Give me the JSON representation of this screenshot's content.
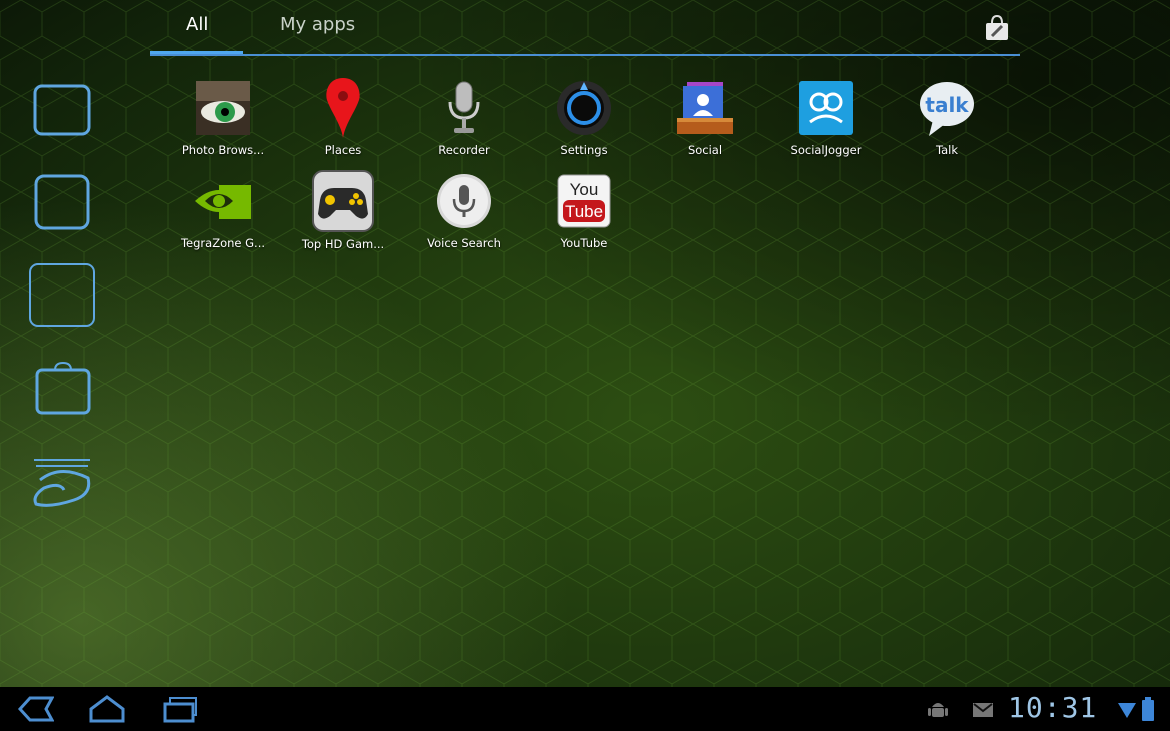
{
  "tabs": {
    "all": "All",
    "my_apps": "My apps"
  },
  "apps": [
    {
      "label": "Photo Brows...",
      "icon": "photo-browser-icon"
    },
    {
      "label": "Places",
      "icon": "places-pin-icon"
    },
    {
      "label": "Recorder",
      "icon": "microphone-icon"
    },
    {
      "label": "Settings",
      "icon": "settings-icon"
    },
    {
      "label": "Social",
      "icon": "social-contacts-icon"
    },
    {
      "label": "SocialJogger",
      "icon": "socialjogger-icon"
    },
    {
      "label": "Talk",
      "icon": "talk-bubble-icon",
      "icon_text": "talk"
    },
    {
      "label": "TegraZone G...",
      "icon": "nvidia-eye-icon"
    },
    {
      "label": "Top HD Gam...",
      "icon": "gamepad-icon"
    },
    {
      "label": "Voice Search",
      "icon": "voice-search-icon"
    },
    {
      "label": "YouTube",
      "icon": "youtube-icon",
      "icon_text_top": "You",
      "icon_text_bottom": "Tube"
    }
  ],
  "sidebar_shortcuts": [
    "widget-frame-icon",
    "app-frame-icon",
    "wallpaper-frame-icon",
    "shopping-bag-icon",
    "tegra-logo-icon"
  ],
  "status_bar": {
    "time": "10:31",
    "icons": [
      "android-debug-icon",
      "gmail-icon",
      "wifi-icon",
      "battery-icon"
    ]
  },
  "colors": {
    "accent": "#4fa7ef",
    "clock": "#9fc6e6",
    "wallpaper_dark": "#12240a",
    "wallpaper_mid": "#2d4e12"
  }
}
